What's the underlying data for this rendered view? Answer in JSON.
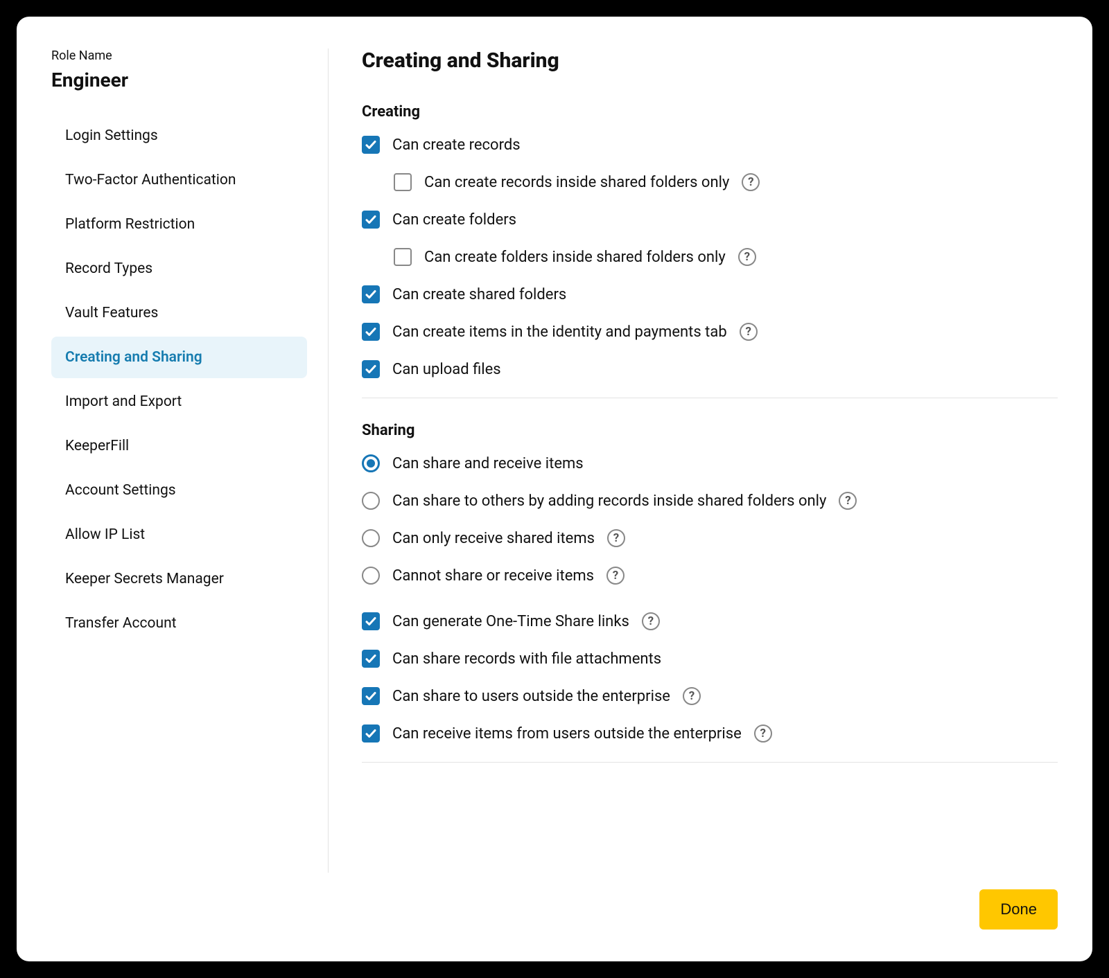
{
  "role_label": "Role Name",
  "role_name": "Engineer",
  "nav": [
    "Login Settings",
    "Two-Factor Authentication",
    "Platform Restriction",
    "Record Types",
    "Vault Features",
    "Creating and Sharing",
    "Import and Export",
    "KeeperFill",
    "Account Settings",
    "Allow IP List",
    "Keeper Secrets Manager",
    "Transfer Account"
  ],
  "nav_active_index": 5,
  "main_title": "Creating and Sharing",
  "sections": {
    "creating": {
      "heading": "Creating",
      "items": {
        "can_create_records": {
          "label": "Can create records",
          "checked": true
        },
        "records_shared_only": {
          "label": "Can create records inside shared folders only",
          "checked": false,
          "help": true
        },
        "can_create_folders": {
          "label": "Can create folders",
          "checked": true
        },
        "folders_shared_only": {
          "label": "Can create folders inside shared folders only",
          "checked": false,
          "help": true
        },
        "can_create_shared_folders": {
          "label": "Can create shared folders",
          "checked": true
        },
        "can_create_identity_payments": {
          "label": "Can create items in the identity and payments tab",
          "checked": true,
          "help": true
        },
        "can_upload_files": {
          "label": "Can upload files",
          "checked": true
        }
      }
    },
    "sharing": {
      "heading": "Sharing",
      "radios": {
        "share_receive": {
          "label": "Can share and receive items",
          "selected": true
        },
        "share_shared_folders_only": {
          "label": "Can share to others by adding records inside shared folders only",
          "selected": false,
          "help": true
        },
        "only_receive": {
          "label": "Can only receive shared items",
          "selected": false,
          "help": true
        },
        "cannot_share_receive": {
          "label": "Cannot share or receive items",
          "selected": false,
          "help": true
        }
      },
      "checks": {
        "one_time_share": {
          "label": "Can generate One-Time Share links",
          "checked": true,
          "help": true
        },
        "share_with_attachments": {
          "label": "Can share records with file attachments",
          "checked": true
        },
        "share_outside": {
          "label": "Can share to users outside the enterprise",
          "checked": true,
          "help": true
        },
        "receive_outside": {
          "label": "Can receive items from users outside the enterprise",
          "checked": true,
          "help": true
        }
      }
    }
  },
  "done_label": "Done",
  "colors": {
    "accent_blue": "#1676b6",
    "nav_active_bg": "#e8f4fa",
    "nav_active_text": "#167caf",
    "done_bg": "#ffc700"
  }
}
